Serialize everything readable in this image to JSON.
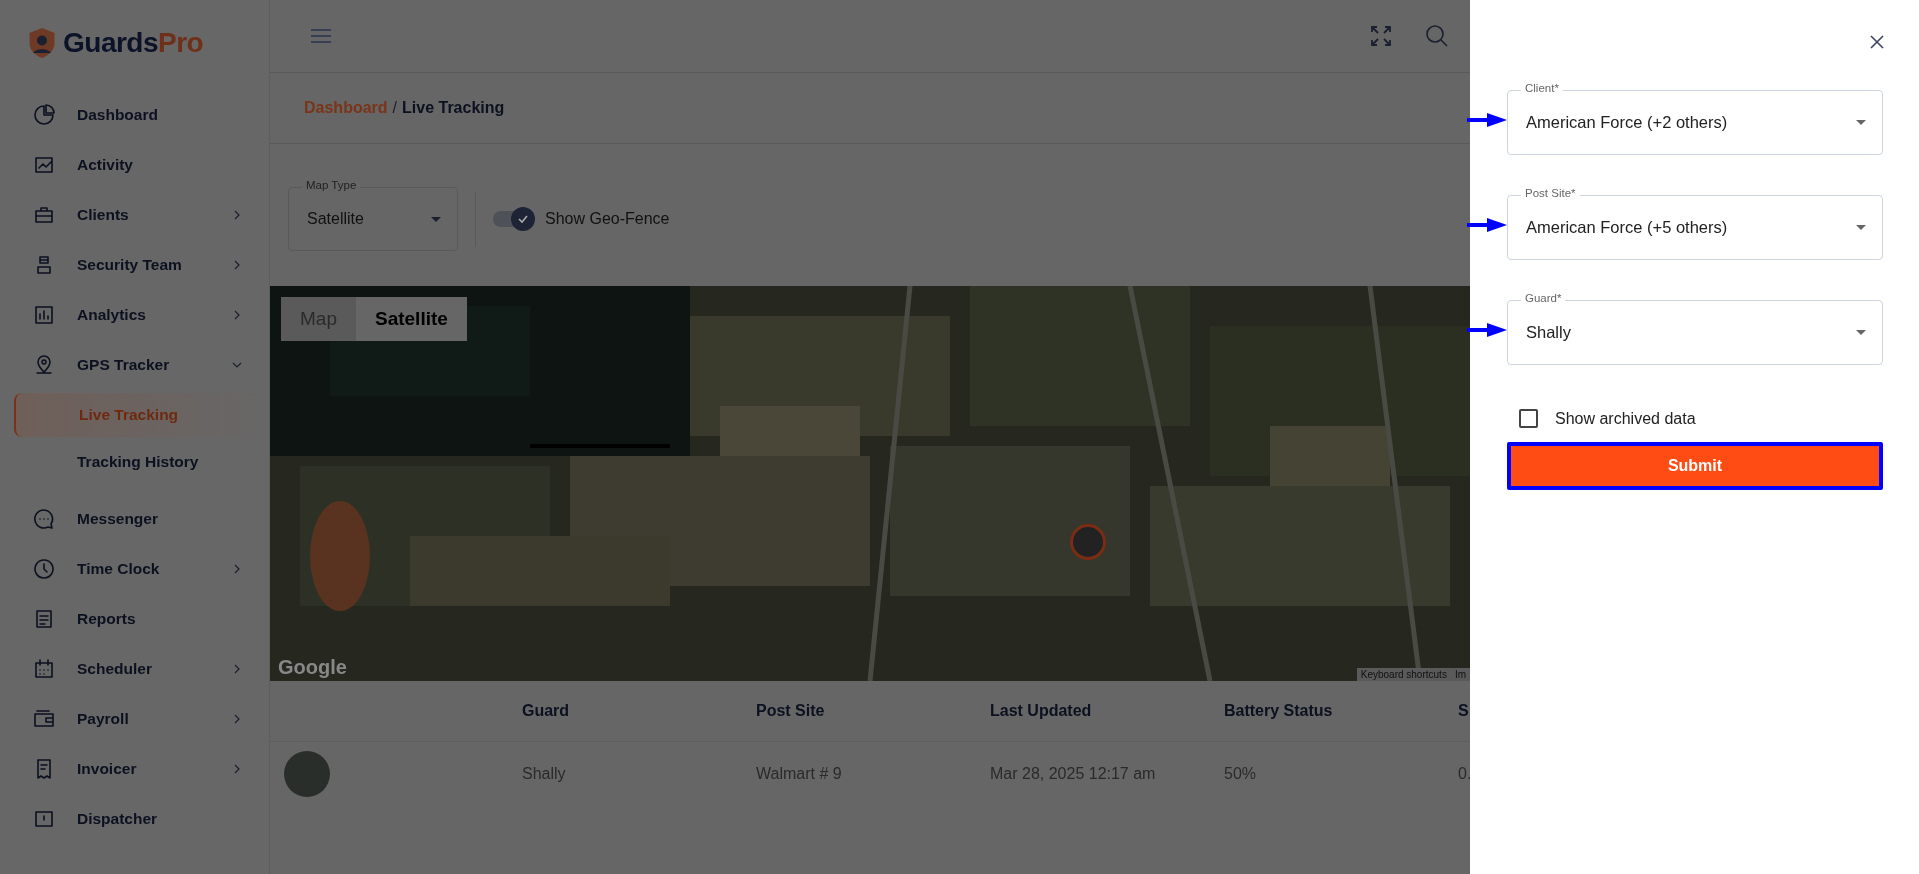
{
  "logo": {
    "text_a": "Guards",
    "text_b": "Pro"
  },
  "sidebar": {
    "items": [
      {
        "label": "Dashboard",
        "expandable": false,
        "expanded": false
      },
      {
        "label": "Activity",
        "expandable": false,
        "expanded": false
      },
      {
        "label": "Clients",
        "expandable": true,
        "expanded": false
      },
      {
        "label": "Security Team",
        "expandable": true,
        "expanded": false
      },
      {
        "label": "Analytics",
        "expandable": true,
        "expanded": false
      },
      {
        "label": "GPS Tracker",
        "expandable": true,
        "expanded": true,
        "children": [
          {
            "label": "Live Tracking",
            "selected": true
          },
          {
            "label": "Tracking History",
            "selected": false
          }
        ]
      },
      {
        "label": "Messenger",
        "expandable": false,
        "expanded": false
      },
      {
        "label": "Time Clock",
        "expandable": true,
        "expanded": false
      },
      {
        "label": "Reports",
        "expandable": false,
        "expanded": false
      },
      {
        "label": "Scheduler",
        "expandable": true,
        "expanded": false
      },
      {
        "label": "Payroll",
        "expandable": true,
        "expanded": false
      },
      {
        "label": "Invoicer",
        "expandable": true,
        "expanded": false
      },
      {
        "label": "Dispatcher",
        "expandable": false,
        "expanded": false
      }
    ]
  },
  "breadcrumb": {
    "link": "Dashboard",
    "separator": "/",
    "current": "Live Tracking"
  },
  "map_type": {
    "label": "Map Type",
    "value": "Satellite"
  },
  "geo_fence": {
    "label": "Show Geo-Fence",
    "on": true
  },
  "map": {
    "tabs": [
      {
        "label": "Map",
        "selected": false
      },
      {
        "label": "Satellite",
        "selected": true
      }
    ],
    "attribution": "Google",
    "footer": [
      "Keyboard shortcuts",
      "Im"
    ]
  },
  "table": {
    "columns": [
      "Guard",
      "Post Site",
      "Last Updated",
      "Battery Status",
      "S"
    ],
    "rows": [
      {
        "guard": "Shally",
        "post_site": "Walmart # 9",
        "last_updated": "Mar 28, 2025 12:17 am",
        "battery": "50%",
        "column_5": "0."
      }
    ]
  },
  "drawer": {
    "fields": [
      {
        "label": "Client*",
        "value": "American Force (+2 others)"
      },
      {
        "label": "Post Site*",
        "value": "American Force (+5 others)"
      },
      {
        "label": "Guard*",
        "value": "Shally"
      }
    ],
    "archived": {
      "label": "Show archived data",
      "checked": false
    },
    "submit": "Submit"
  }
}
